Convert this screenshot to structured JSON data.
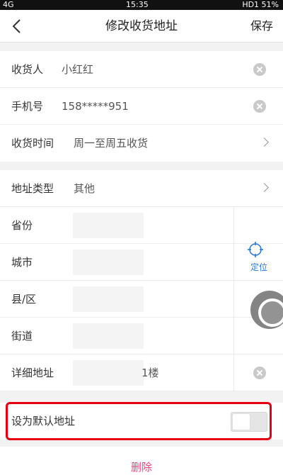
{
  "status_bar": {
    "left": "4G",
    "time": "15:35",
    "right": "HD1 51%"
  },
  "header": {
    "title": "修改收货地址",
    "save_label": "保存"
  },
  "contact": {
    "receiver": {
      "label": "收货人",
      "value": "小红红"
    },
    "phone": {
      "label": "手机号",
      "value": "158*****951"
    },
    "delivery_time": {
      "label": "收货时间",
      "value": "周一至周五收货"
    }
  },
  "address": {
    "type": {
      "label": "地址类型",
      "value": "其他"
    },
    "province": {
      "label": "省份"
    },
    "city": {
      "label": "城市"
    },
    "district": {
      "label": "县/区"
    },
    "street": {
      "label": "街道"
    },
    "detail": {
      "label": "详细地址",
      "value_suffix": "1楼"
    },
    "locate_label": "定位"
  },
  "default_address": {
    "label": "设为默认地址",
    "enabled": false
  },
  "delete_label": "删除",
  "colors": {
    "accent": "#2d7bd6",
    "delete": "#e8477a",
    "highlight": "#e60012"
  }
}
